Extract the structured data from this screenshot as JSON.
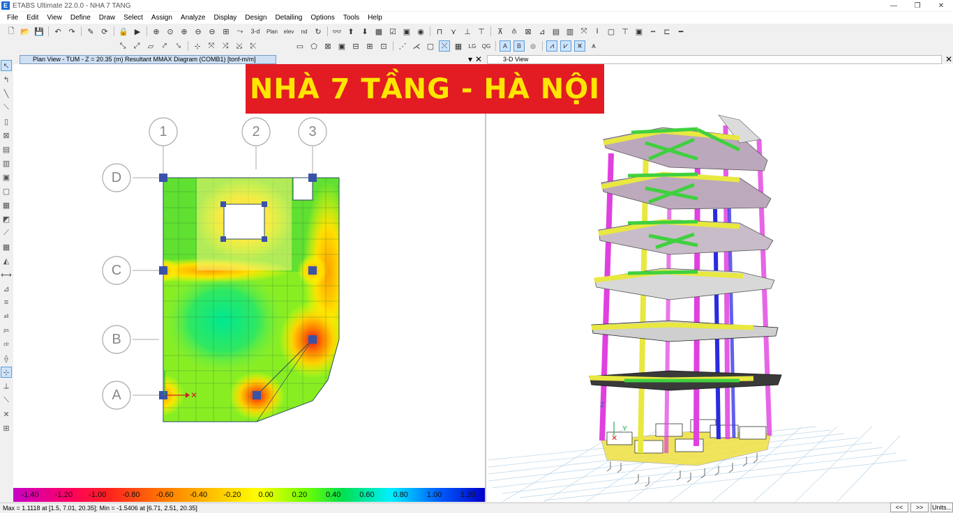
{
  "window": {
    "title": "ETABS Ultimate 22.0.0 - NHA 7 TANG",
    "app_icon": "E"
  },
  "menu": [
    "File",
    "Edit",
    "View",
    "Define",
    "Draw",
    "Select",
    "Assign",
    "Analyze",
    "Display",
    "Design",
    "Detailing",
    "Options",
    "Tools",
    "Help"
  ],
  "toolbar": {
    "three_d_label": "3-d",
    "plan_label": "Plan",
    "elev_label": "elev",
    "nd_label": "nd"
  },
  "plan_view": {
    "tab_label": "Plan View - TUM - Z = 20.35 (m)   Resultant MMAX Diagram   (COMB1)  [tonf-m/m]",
    "grid_columns": [
      "1",
      "2",
      "3"
    ],
    "grid_rows": [
      "D",
      "C",
      "B",
      "A"
    ]
  },
  "view3d": {
    "tab_label": "3-D View"
  },
  "banner": {
    "text": "NHÀ 7 TẦNG - HÀ NỘI"
  },
  "legend": {
    "values": [
      "-1.40",
      "-1.20",
      "-1.00",
      "-0.80",
      "-0.60",
      "-0.40",
      "-0.20",
      "0.00",
      "0.20",
      "0.40",
      "0.60",
      "0.80",
      "1.00",
      "1.20"
    ]
  },
  "status": {
    "text": "Max = 1.1118 at [1.5, 7.01, 20.35];  Min = -1.5406 at [6.71, 2.51, 20.35]",
    "prev_label": "<<",
    "next_label": ">>",
    "units_label": "Units..."
  },
  "colors": {
    "banner_bg": "#e31b23",
    "banner_text": "#ffe600",
    "column": "#e040e0",
    "beam": "#e8e840",
    "support": "#50c850"
  }
}
